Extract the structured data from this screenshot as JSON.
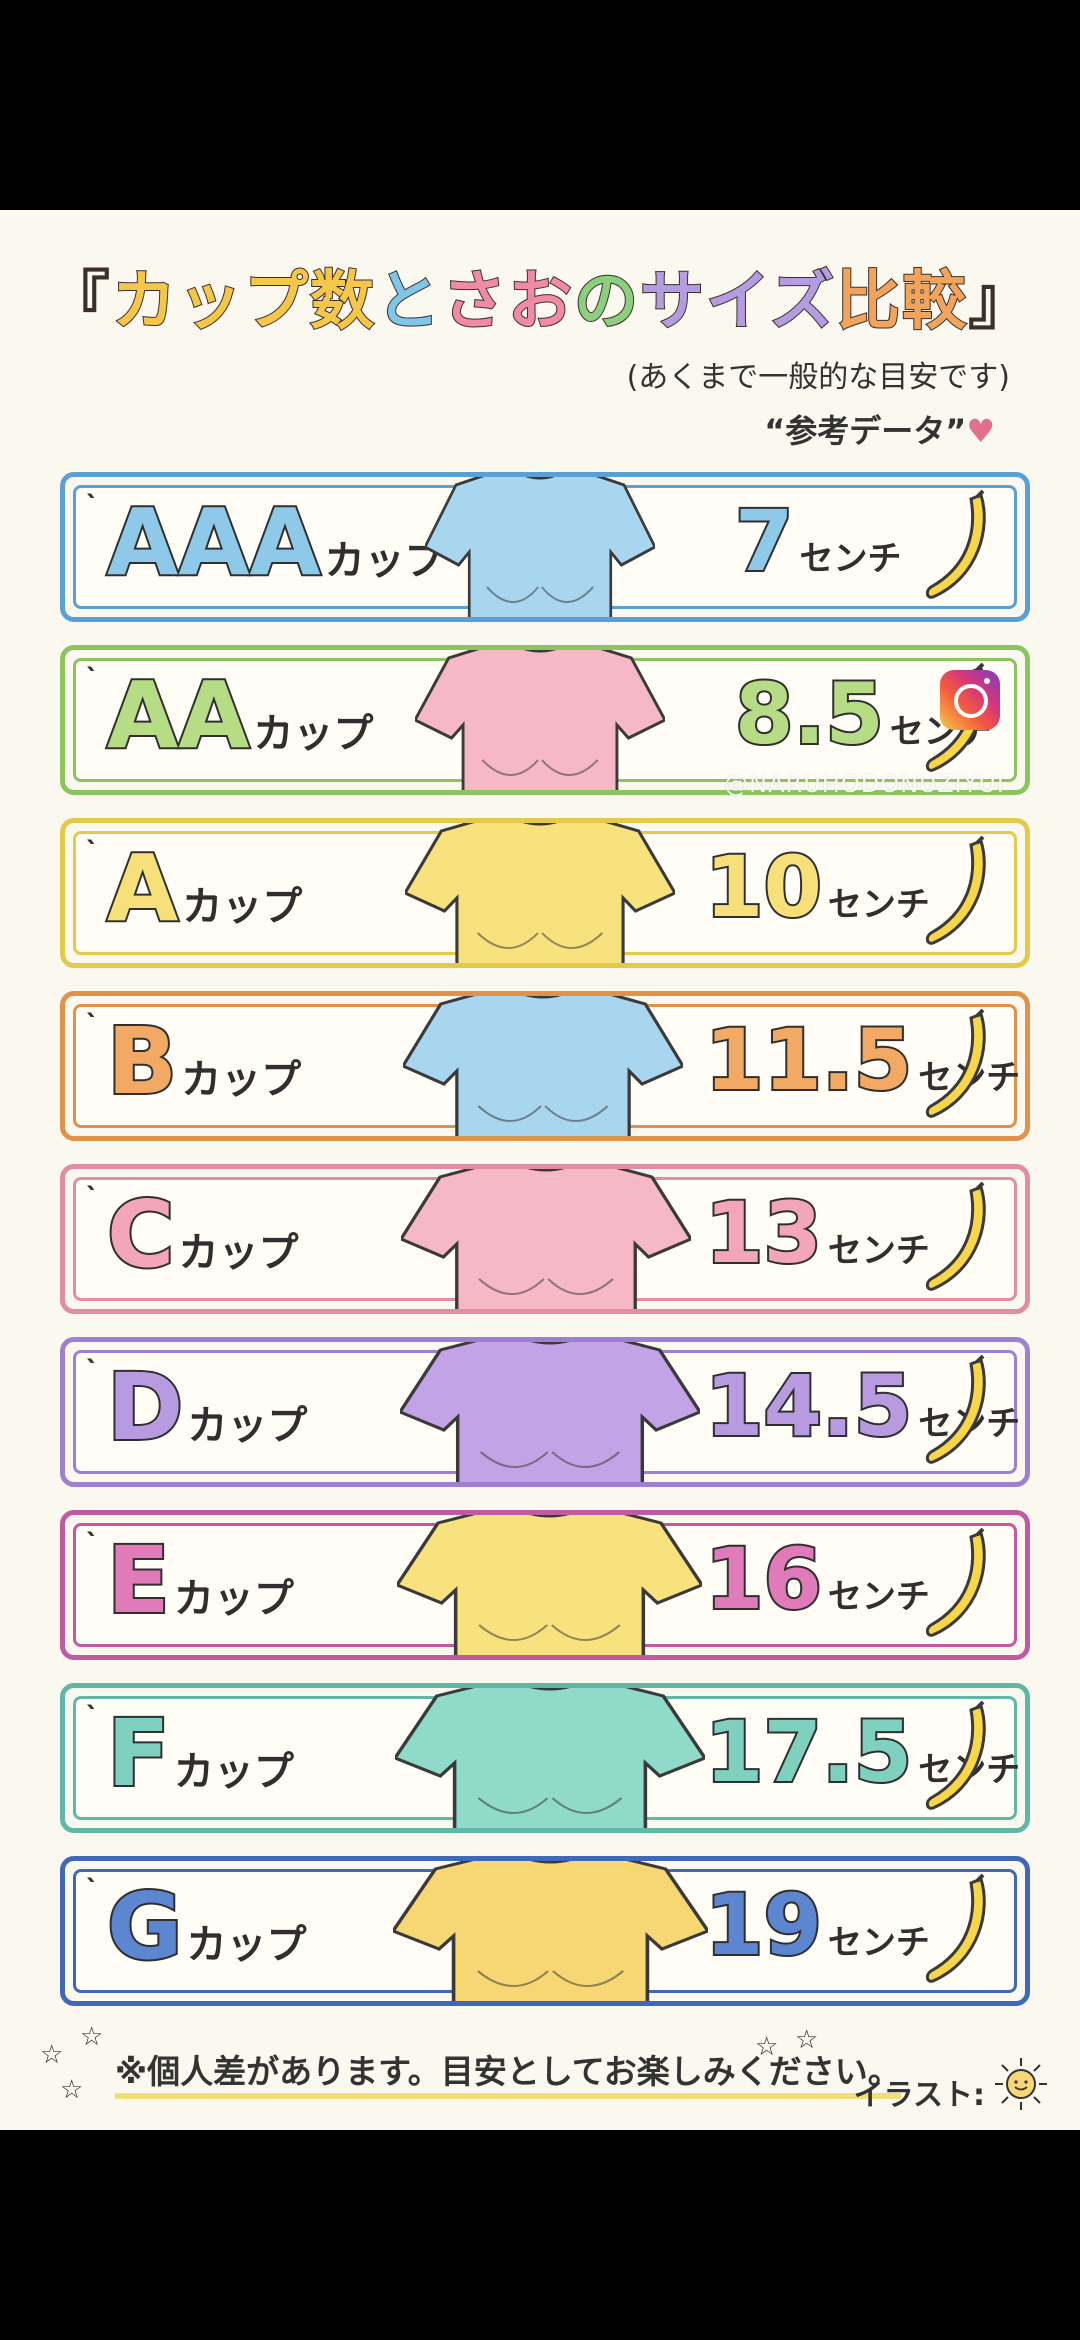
{
  "title": {
    "open": "『",
    "part1": "カップ数",
    "part2": "と",
    "part3": "さお",
    "part4": "の",
    "part5": "サイズ",
    "part6": "比較",
    "close": "』"
  },
  "subtitle": "(あくまで一般的な目安です)",
  "reference_note": "“参考データ”",
  "heart_glyph": "♥",
  "rows": [
    {
      "cup": "AAA",
      "suffix": "カップ",
      "size": "7",
      "unit": "センチ",
      "color": "#8ec9ea",
      "border": "#5a9fd6",
      "shirt": "#a9d6ef"
    },
    {
      "cup": "AA",
      "suffix": "カップ",
      "size": "8.5",
      "unit": "センチ",
      "color": "#b6dd86",
      "border": "#8cc45e",
      "shirt": "#f5b8c4"
    },
    {
      "cup": "A",
      "suffix": "カップ",
      "size": "10",
      "unit": "センチ",
      "color": "#f7e07a",
      "border": "#e5c94b",
      "shirt": "#f7e27e"
    },
    {
      "cup": "B",
      "suffix": "カップ",
      "size": "11.5",
      "unit": "センチ",
      "color": "#f1a963",
      "border": "#e0924a",
      "shirt": "#a9d6ef"
    },
    {
      "cup": "C",
      "suffix": "カップ",
      "size": "13",
      "unit": "センチ",
      "color": "#f3a6b7",
      "border": "#e28ea0",
      "shirt": "#f5b8c4"
    },
    {
      "cup": "D",
      "suffix": "カップ",
      "size": "14.5",
      "unit": "センチ",
      "color": "#b89ae0",
      "border": "#9e7fd0",
      "shirt": "#c1a3e6"
    },
    {
      "cup": "E",
      "suffix": "カップ",
      "size": "16",
      "unit": "センチ",
      "color": "#e07ab8",
      "border": "#c15aa0",
      "shirt": "#f7e27e"
    },
    {
      "cup": "F",
      "suffix": "カップ",
      "size": "17.5",
      "unit": "センチ",
      "color": "#7fd0bf",
      "border": "#5fb8a6",
      "shirt": "#8fdac9"
    },
    {
      "cup": "G",
      "suffix": "カップ",
      "size": "19",
      "unit": "センチ",
      "color": "#5d86d0",
      "border": "#3f68b8",
      "shirt": "#f7d774"
    }
  ],
  "footer_note": "※個人差があります。目安としてお楽しみください。",
  "credit": "イラスト:",
  "watermark": "@NARUHODONUZIYUI",
  "icons": {
    "banana": "banana-icon",
    "shirt": "t-shirt-icon",
    "instagram": "instagram-icon",
    "sun": "sun-icon"
  }
}
